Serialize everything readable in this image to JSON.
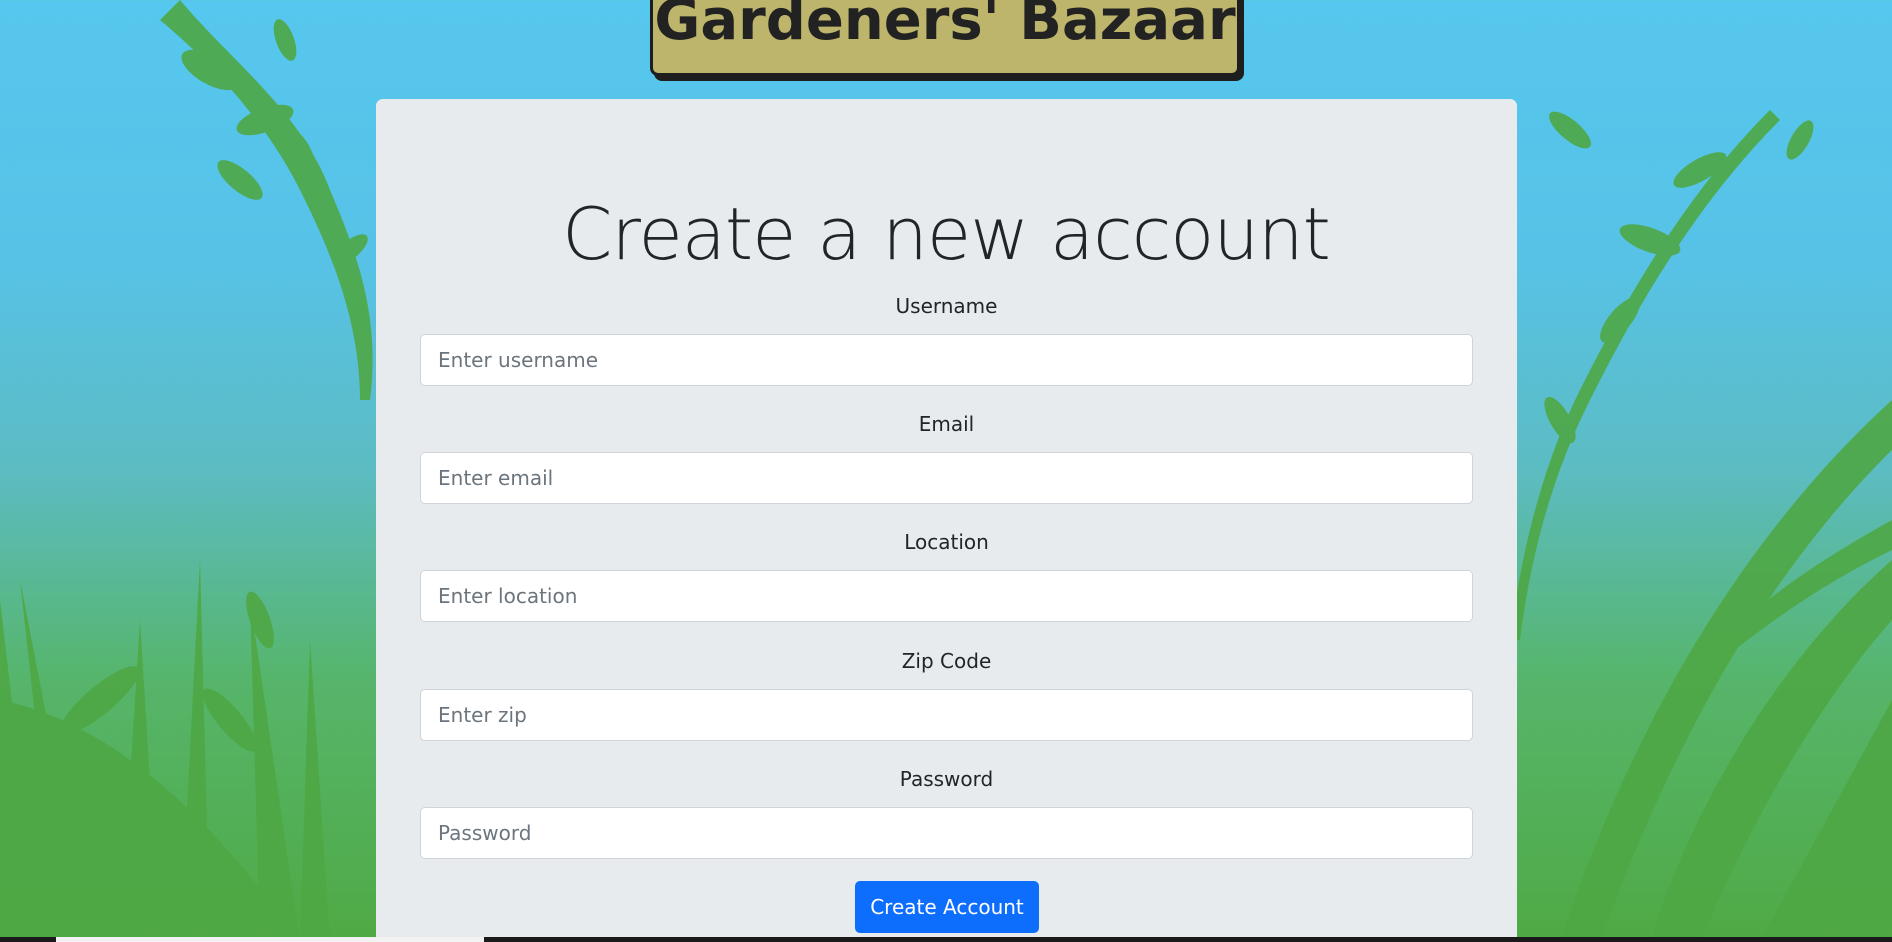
{
  "site": {
    "logo_text": "Gardeners' Bazaar"
  },
  "form": {
    "title": "Create a new account",
    "fields": [
      {
        "label": "Username",
        "placeholder": "Enter username"
      },
      {
        "label": "Email",
        "placeholder": "Enter email"
      },
      {
        "label": "Location",
        "placeholder": "Enter location"
      },
      {
        "label": "Zip Code",
        "placeholder": "Enter zip"
      },
      {
        "label": "Password",
        "placeholder": "Password"
      }
    ],
    "submit_label": "Create Account"
  },
  "colors": {
    "primary_button": "#0d6efd",
    "logo_background": "#bdb56b",
    "card_background": "#e8ebee",
    "sky": "#56c7ee",
    "grass": "#4faa44"
  }
}
